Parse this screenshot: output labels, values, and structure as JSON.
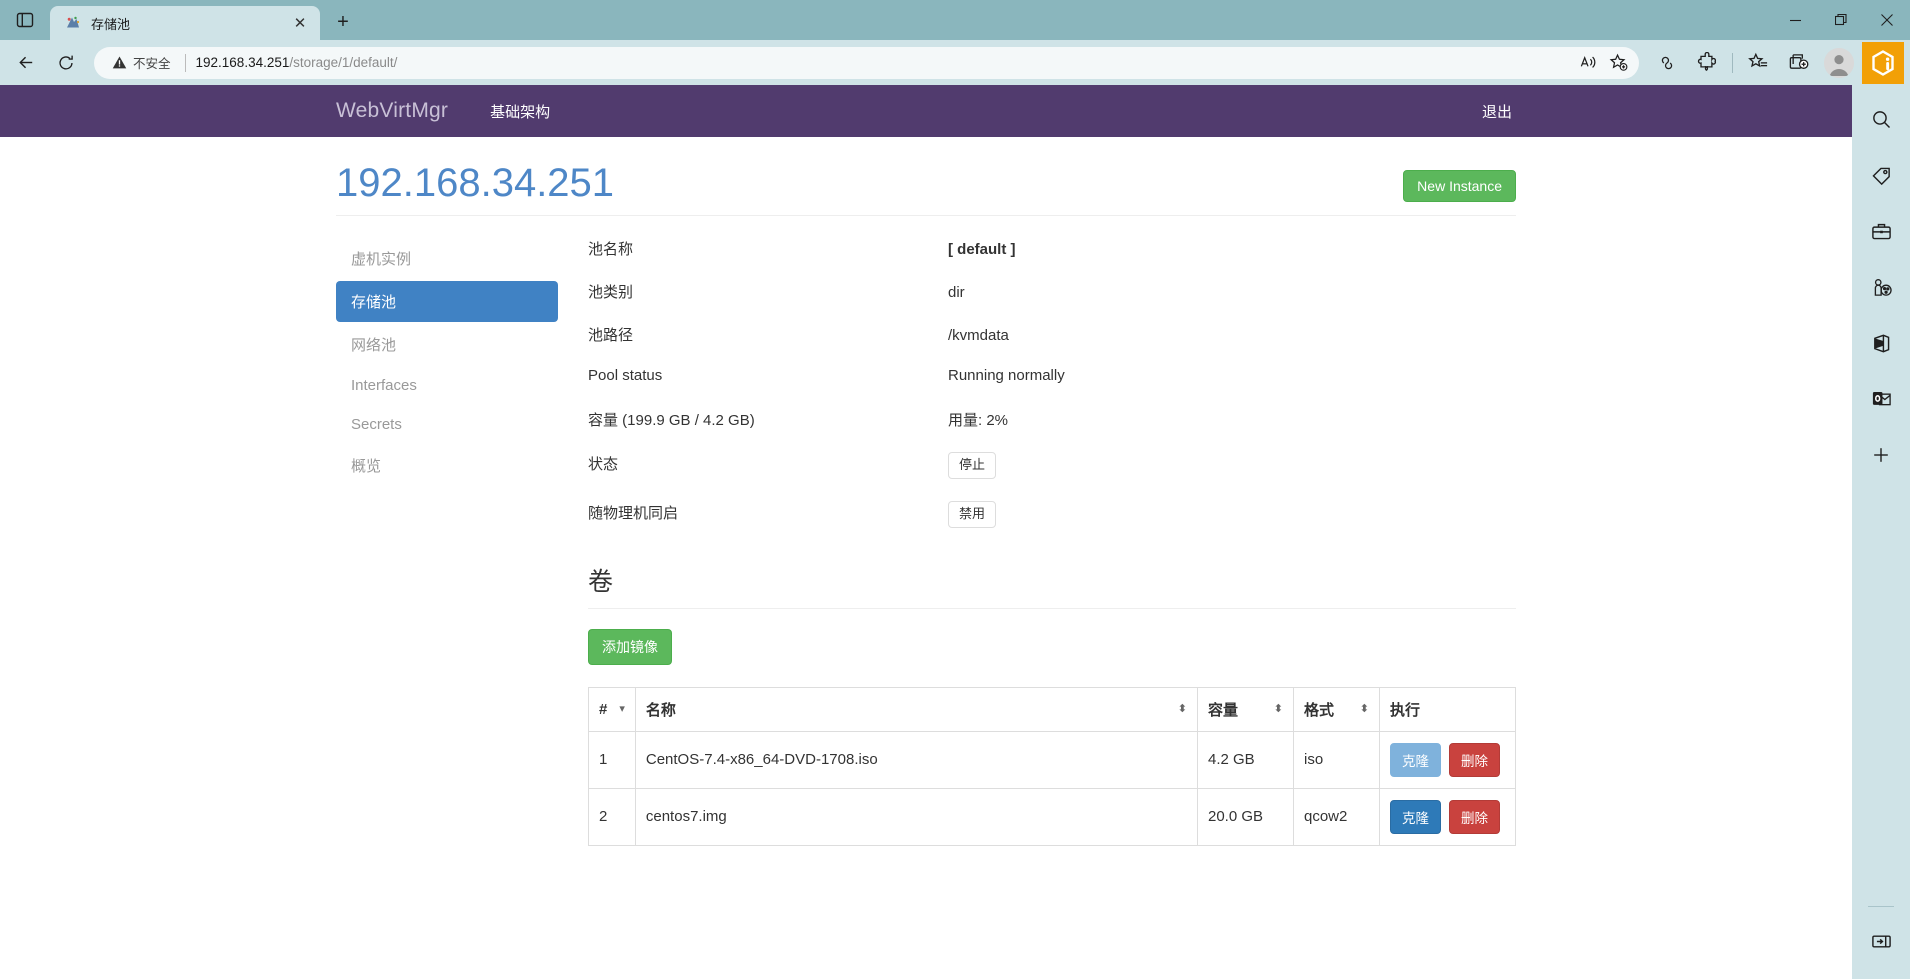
{
  "browser": {
    "tab": {
      "title": "存储池",
      "favicon": "webvirtmgr-favicon",
      "close_label": "✕"
    },
    "new_tab_label": "+",
    "window_controls": {
      "minimize": "minimize-icon",
      "restore": "restore-icon",
      "close": "close-icon"
    },
    "address_bar": {
      "security_label": "不安全",
      "url_host": "192.168.34.251",
      "url_path": "/storage/1/default/",
      "read_aloud_icon": "read-aloud-icon",
      "favorite_icon": "add-favorite-icon"
    },
    "toolbar_icons": [
      "infinity-icon",
      "extensions-icon",
      "collections-icon",
      "split-screen-icon"
    ],
    "avatar": "profile-avatar",
    "copilot": "copilot-icon",
    "edge_sidebar_icons": [
      "search-icon",
      "tag-icon",
      "briefcase-icon",
      "games-icon",
      "office-icon",
      "outlook-icon",
      "add-tool-icon"
    ],
    "edge_sidebar_bottom_icon": "sidebar-toggle-icon"
  },
  "app": {
    "brand": "WebVirtMgr",
    "nav_links": [
      {
        "label": "基础架构"
      }
    ],
    "logout_label": "退出"
  },
  "header": {
    "title": "192.168.34.251",
    "new_instance_label": "New Instance"
  },
  "sidebar": {
    "items": [
      {
        "label": "虚机实例",
        "active": false
      },
      {
        "label": "存储池",
        "active": true
      },
      {
        "label": "网络池",
        "active": false
      },
      {
        "label": "Interfaces",
        "active": false
      },
      {
        "label": "Secrets",
        "active": false
      },
      {
        "label": "概览",
        "active": false
      }
    ]
  },
  "pool_details": [
    {
      "term": "池名称",
      "value": "[ default ]",
      "bold": true,
      "type": "text"
    },
    {
      "term": "池类别",
      "value": "dir",
      "bold": false,
      "type": "text"
    },
    {
      "term": "池路径",
      "value": "/kvmdata",
      "bold": false,
      "type": "text"
    },
    {
      "term": "Pool status",
      "value": "Running normally",
      "bold": false,
      "type": "text"
    },
    {
      "term": "容量 (199.9 GB / 4.2 GB)",
      "value": "用量: 2%",
      "bold": false,
      "type": "text"
    },
    {
      "term": "状态",
      "value": "停止",
      "bold": false,
      "type": "badge"
    },
    {
      "term": "随物理机同启",
      "value": "禁用",
      "bold": false,
      "type": "badge"
    }
  ],
  "volumes": {
    "section_title": "卷",
    "add_image_label": "添加镜像",
    "columns": [
      {
        "label": "#",
        "sort": "▾"
      },
      {
        "label": "名称",
        "sort": "⬍"
      },
      {
        "label": "容量",
        "sort": "⬍"
      },
      {
        "label": "格式",
        "sort": "⬍"
      },
      {
        "label": "执行",
        "sort": ""
      }
    ],
    "rows": [
      {
        "index": "1",
        "name": "CentOS-7.4-x86_64-DVD-1708.iso",
        "capacity": "4.2 GB",
        "format": "iso",
        "clone_label": "克隆",
        "delete_label": "删除",
        "clone_muted": true
      },
      {
        "index": "2",
        "name": "centos7.img",
        "capacity": "20.0 GB",
        "format": "qcow2",
        "clone_label": "克隆",
        "delete_label": "删除",
        "clone_muted": false
      }
    ]
  },
  "colors": {
    "navbar_purple": "#513b6e",
    "title_blue": "#4e87c7",
    "active_pill_blue": "#4082c4",
    "success_green": "#5cb85c",
    "primary_blue": "#2e7ab8",
    "danger_red": "#c9423e",
    "browser_chrome": "#8ab6bd",
    "copilot_orange": "#f2a007"
  }
}
